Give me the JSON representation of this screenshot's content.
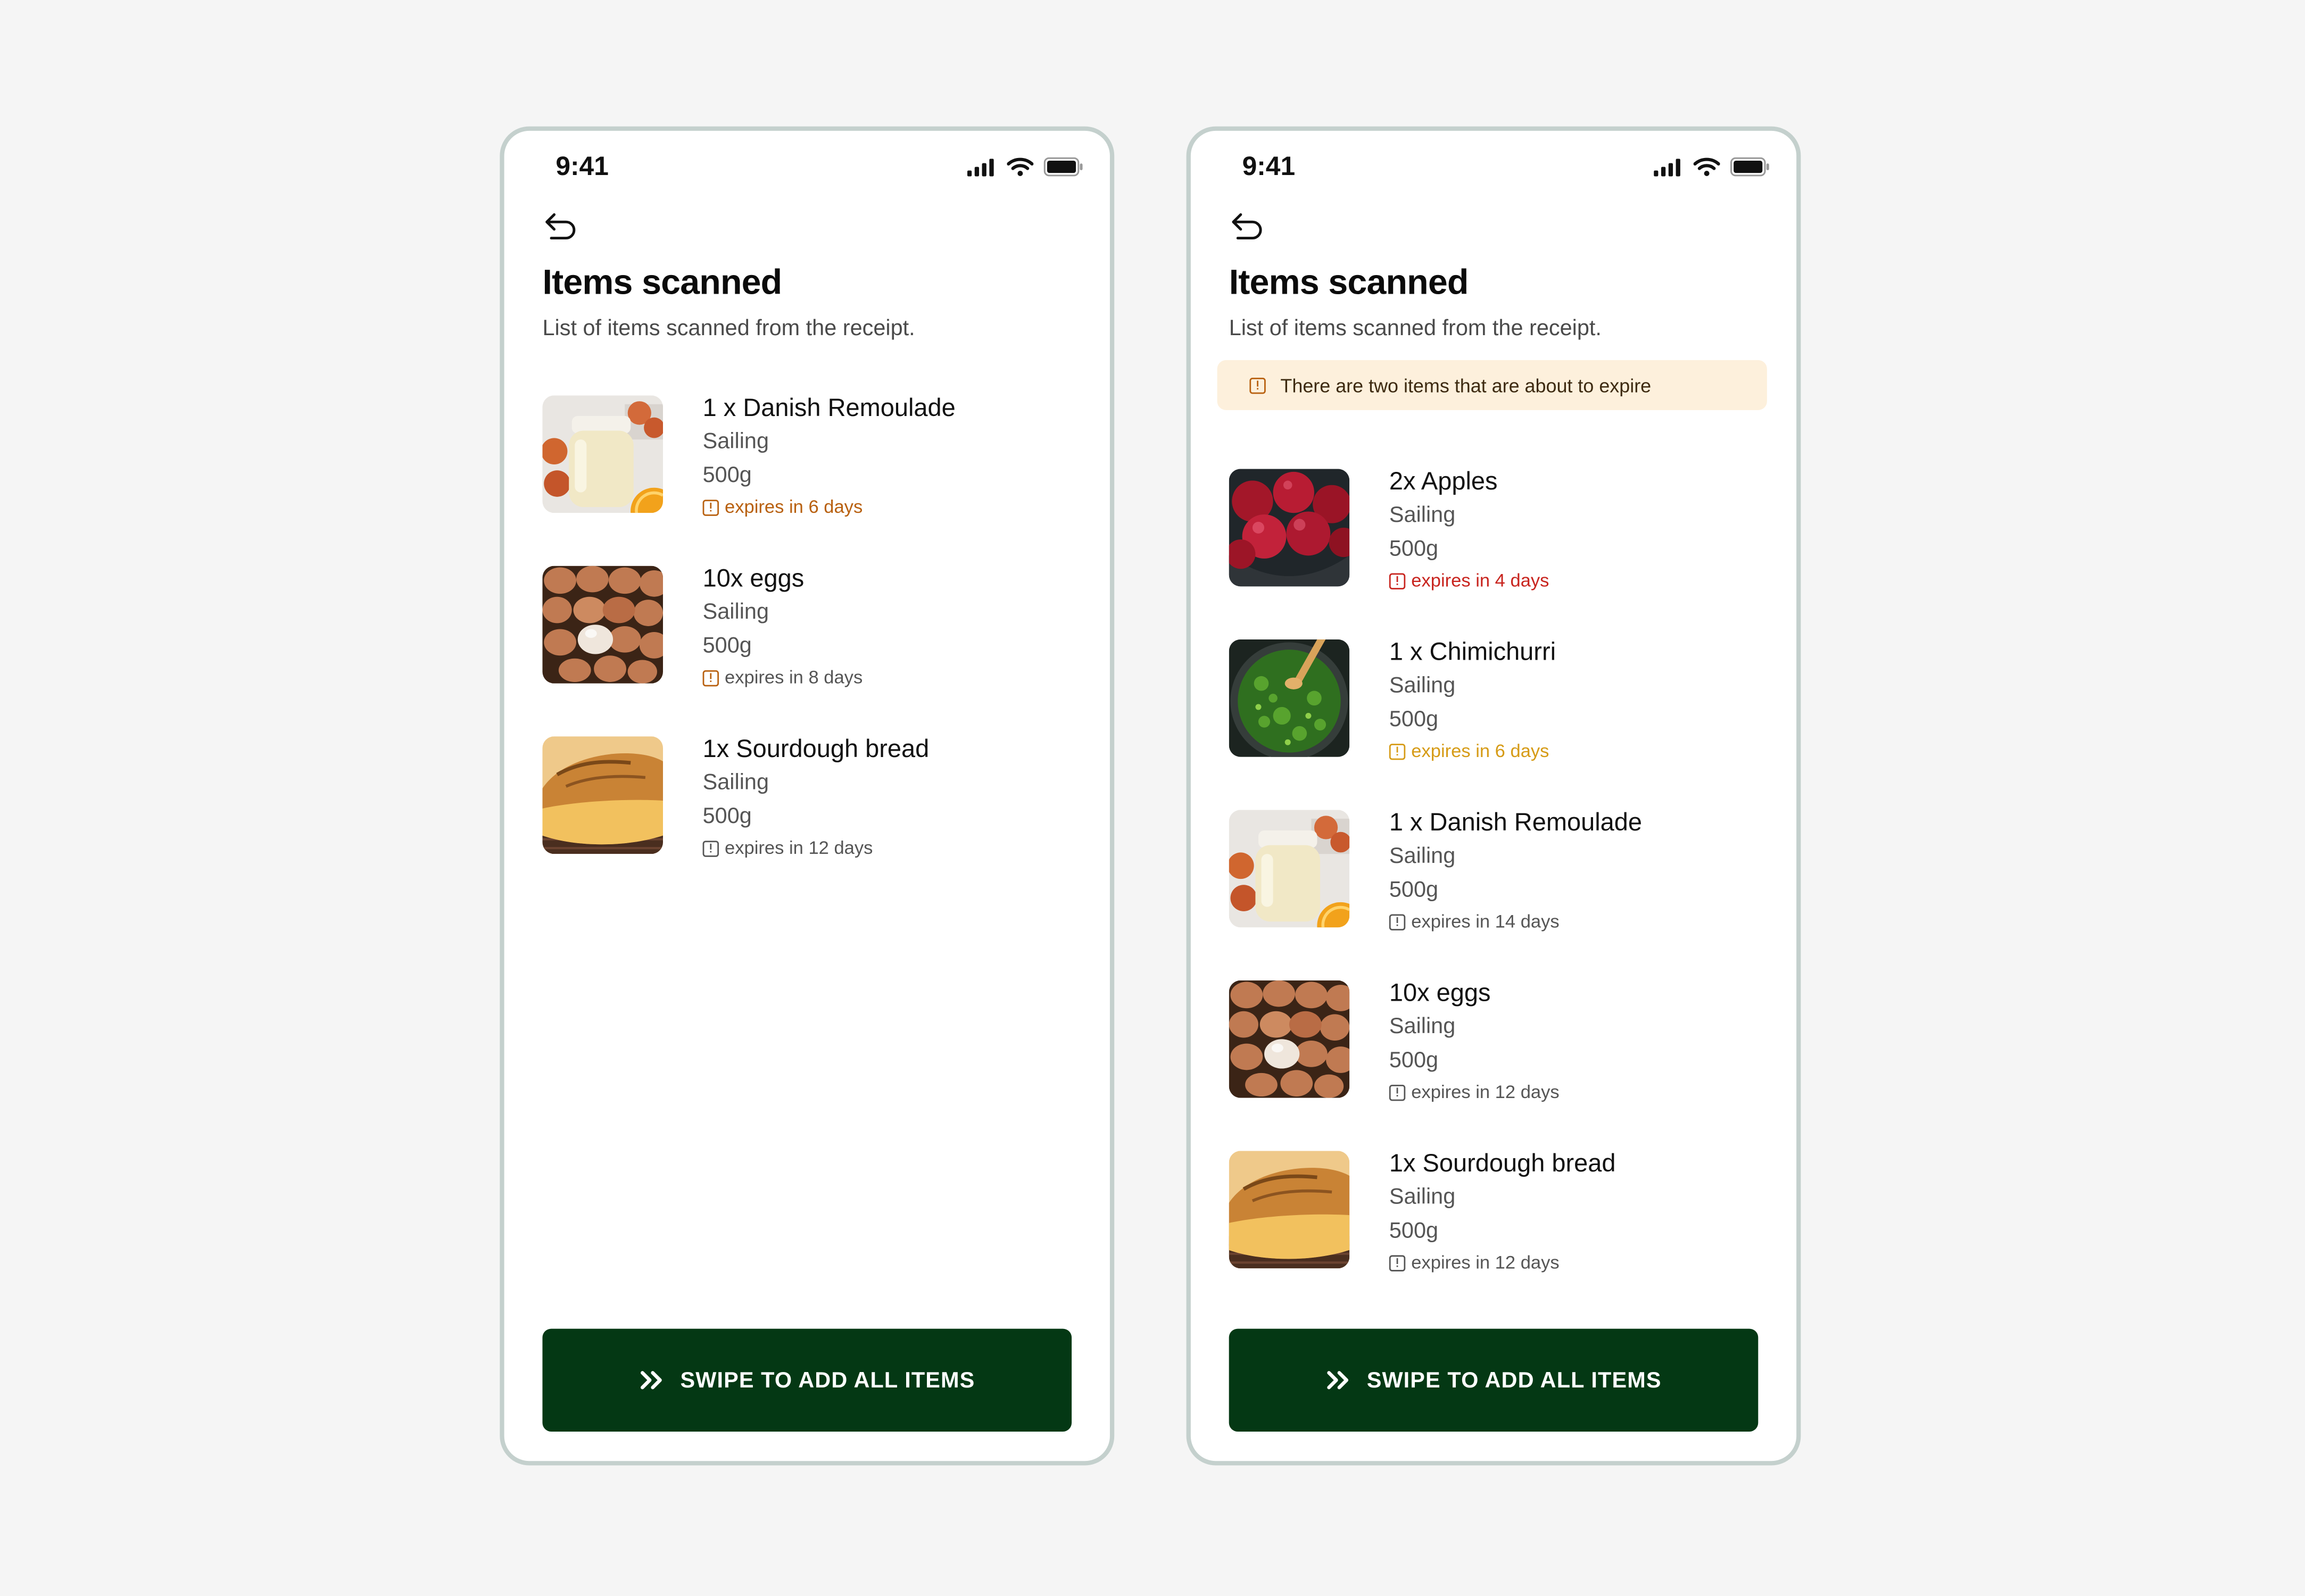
{
  "colors": {
    "background": "#f5f5f5",
    "phone_border": "#c4d0cd",
    "cta_bg": "#043814",
    "banner_bg": "#fdf0dc",
    "expiry_orange": "#b8600f",
    "expiry_red": "#c8241e",
    "expiry_gold": "#d69b16",
    "expiry_gray": "#555555"
  },
  "status_bar": {
    "time": "9:41"
  },
  "screen": {
    "title": "Items scanned",
    "subtitle": "List of items scanned from the receipt.",
    "cta_label": "SWIPE TO ADD ALL ITEMS",
    "cta_icon": "double-chevron-right-icon",
    "back_icon": "undo-back-icon"
  },
  "left": {
    "items": [
      {
        "name": "1 x Danish Remoulade",
        "brand": "Sailing",
        "weight": "500g",
        "expiry": "expires in 6 days",
        "image": "remoulade-jar"
      },
      {
        "name": "10x eggs",
        "brand": "Sailing",
        "weight": "500g",
        "expiry": "expires in 8 days",
        "image": "eggs"
      },
      {
        "name": "1x Sourdough bread",
        "brand": "Sailing",
        "weight": "500g",
        "expiry": "expires in 12 days",
        "image": "bread"
      }
    ]
  },
  "right": {
    "banner": "There are two items that are about to expire",
    "items": [
      {
        "name": "2x Apples",
        "brand": "Sailing",
        "weight": "500g",
        "expiry": "expires in 4 days",
        "image": "apples"
      },
      {
        "name": "1 x Chimichurri",
        "brand": "Sailing",
        "weight": "500g",
        "expiry": "expires in 6 days",
        "image": "chimichurri"
      },
      {
        "name": "1 x Danish Remoulade",
        "brand": "Sailing",
        "weight": "500g",
        "expiry": "expires in 14 days",
        "image": "remoulade-jar"
      },
      {
        "name": "10x eggs",
        "brand": "Sailing",
        "weight": "500g",
        "expiry": "expires in 12 days",
        "image": "eggs"
      },
      {
        "name": "1x Sourdough bread",
        "brand": "Sailing",
        "weight": "500g",
        "expiry": "expires in 12 days",
        "image": "bread"
      }
    ]
  }
}
